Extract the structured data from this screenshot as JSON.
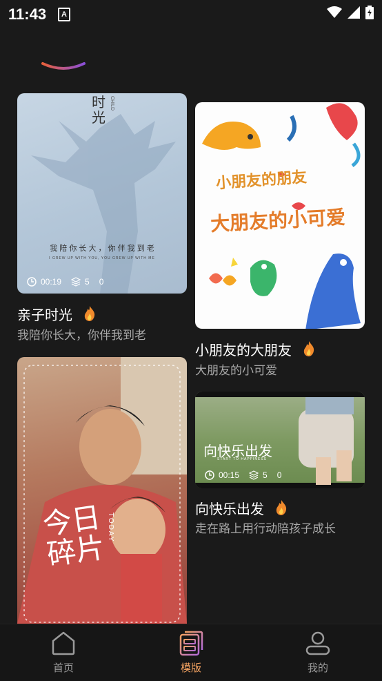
{
  "status": {
    "time": "11:43",
    "notification_icon": "A"
  },
  "cards": [
    {
      "title": "亲子时光",
      "subtitle": "我陪你长大，你伴我到老",
      "image": {
        "heading": "时光",
        "side_text": "CHILD",
        "caption": "我 陪 你 长 大 ， 你 伴 我 到 老",
        "caption_en": "I GREW UP WITH YOU, YOU GREW UP WITH ME"
      },
      "meta": {
        "duration": "00:19",
        "layers": "5",
        "count": "0"
      }
    },
    {
      "title": "小朋友的大朋友",
      "subtitle": "大朋友的小可爱",
      "image": {
        "line1": "小朋友的朋友",
        "line2": "大朋友的小可爱"
      }
    },
    {
      "title": "向快乐出发",
      "subtitle": "走在路上用行动陪孩子成长",
      "image": {
        "heading": "向快乐出发",
        "tagline": "START TO HAPPINESS"
      },
      "meta": {
        "duration": "00:15",
        "layers": "5",
        "count": "0"
      }
    },
    {
      "title": "",
      "subtitle": "",
      "image": {
        "heading": "今日碎片",
        "side_text": "TODAY"
      }
    }
  ],
  "tabs": [
    {
      "label": "首页",
      "icon": "home-icon",
      "active": false
    },
    {
      "label": "模版",
      "icon": "template-icon",
      "active": true
    },
    {
      "label": "我的",
      "icon": "profile-icon",
      "active": false
    }
  ],
  "colors": {
    "active": "#f0a060",
    "inactive": "#9a9a9a",
    "background": "#1a1a1a"
  }
}
